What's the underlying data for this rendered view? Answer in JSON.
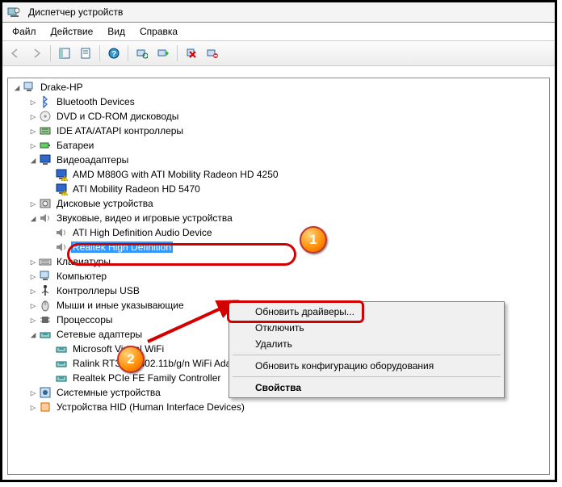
{
  "window": {
    "title": "Диспетчер устройств"
  },
  "menus": {
    "file": "Файл",
    "action": "Действие",
    "view": "Вид",
    "help": "Справка"
  },
  "tree": {
    "root": "Drake-HP",
    "items": [
      {
        "label": "Bluetooth Devices",
        "icon": "bt",
        "expandable": true,
        "open": false,
        "depth": 1
      },
      {
        "label": "DVD и CD-ROM дисководы",
        "icon": "cd",
        "expandable": true,
        "open": false,
        "depth": 1
      },
      {
        "label": "IDE ATA/ATAPI контроллеры",
        "icon": "ide",
        "expandable": true,
        "open": false,
        "depth": 1
      },
      {
        "label": "Батареи",
        "icon": "bat",
        "expandable": true,
        "open": false,
        "depth": 1
      },
      {
        "label": "Видеоадаптеры",
        "icon": "disp",
        "expandable": true,
        "open": true,
        "depth": 1
      },
      {
        "label": "AMD M880G with ATI Mobility Radeon HD 4250",
        "icon": "disp",
        "depth": 2,
        "warn": true
      },
      {
        "label": "ATI Mobility Radeon HD 5470",
        "icon": "disp",
        "depth": 2,
        "warn": true
      },
      {
        "label": "Дисковые устройства",
        "icon": "hdd",
        "expandable": true,
        "open": false,
        "depth": 1
      },
      {
        "label": "Звуковые, видео и игровые устройства",
        "icon": "snd",
        "expandable": true,
        "open": true,
        "depth": 1,
        "marker": 1
      },
      {
        "label": "ATI High Definition Audio Device",
        "icon": "snd",
        "depth": 2
      },
      {
        "label": "Realtek High Definition",
        "icon": "snd",
        "depth": 2,
        "selected": true,
        "truncated": true
      },
      {
        "label": "Клавиатуры",
        "icon": "kb",
        "expandable": true,
        "open": false,
        "depth": 1
      },
      {
        "label": "Компьютер",
        "icon": "pc",
        "expandable": true,
        "open": false,
        "depth": 1
      },
      {
        "label": "Контроллеры USB",
        "icon": "usb",
        "expandable": true,
        "open": false,
        "depth": 1
      },
      {
        "label": "Мыши и иные указывающие",
        "icon": "mouse",
        "expandable": true,
        "open": false,
        "depth": 1,
        "truncated": true
      },
      {
        "label": "Процессоры",
        "icon": "cpu",
        "expandable": true,
        "open": false,
        "depth": 1,
        "marker": 2
      },
      {
        "label": "Сетевые адаптеры",
        "icon": "net",
        "expandable": true,
        "open": true,
        "depth": 1
      },
      {
        "label": "Microsoft Virtual WiFi",
        "icon": "net",
        "depth": 2,
        "truncated": true
      },
      {
        "label": "Ralink RT3090 802.11b/g/n WiFi Adapter",
        "icon": "net",
        "depth": 2
      },
      {
        "label": "Realtek PCIe FE Family Controller",
        "icon": "net",
        "depth": 2
      },
      {
        "label": "Системные устройства",
        "icon": "sys",
        "expandable": true,
        "open": false,
        "depth": 1
      },
      {
        "label": "Устройства HID (Human Interface Devices)",
        "icon": "hid",
        "expandable": true,
        "open": false,
        "depth": 1
      }
    ]
  },
  "context_menu": {
    "update": "Обновить драйверы...",
    "disable": "Отключить",
    "delete": "Удалить",
    "scan": "Обновить конфигурацию оборудования",
    "props": "Свойства"
  },
  "badges": {
    "one": "1",
    "two": "2"
  },
  "colors": {
    "accent": "#3399ff",
    "annot": "#d40000"
  }
}
